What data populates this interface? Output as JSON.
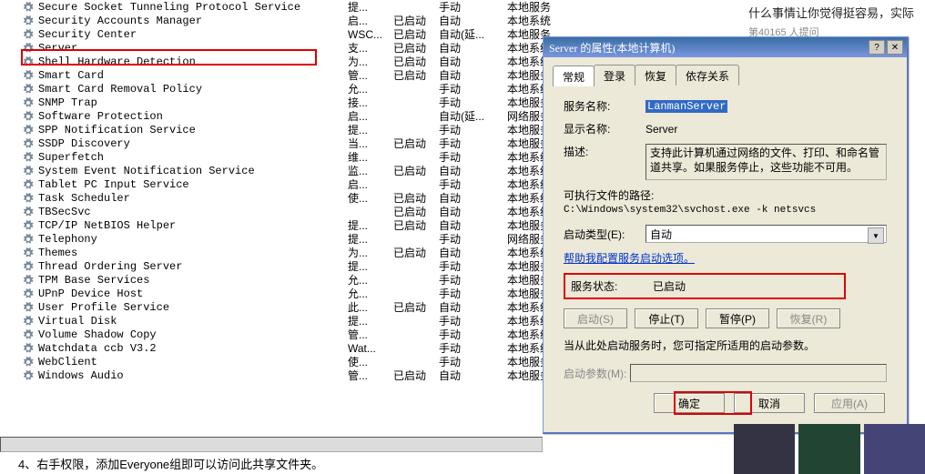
{
  "article": {
    "line1": "什么事情让你觉得挺容易，实际",
    "line2": "第40165 人提问"
  },
  "columns": [
    "name",
    "desc",
    "status",
    "startup",
    "logon"
  ],
  "services": [
    {
      "name": "Secure Socket Tunneling Protocol Service",
      "desc": "提...",
      "status": "",
      "startup": "手动",
      "logon": "本地服务"
    },
    {
      "name": "Security Accounts Manager",
      "desc": "启...",
      "status": "已启动",
      "startup": "自动",
      "logon": "本地系统"
    },
    {
      "name": "Security Center",
      "desc": "WSC...",
      "status": "已启动",
      "startup": "自动(延...",
      "logon": "本地服务"
    },
    {
      "name": "Server",
      "desc": "支...",
      "status": "已启动",
      "startup": "自动",
      "logon": "本地系统"
    },
    {
      "name": "Shell Hardware Detection",
      "desc": "为...",
      "status": "已启动",
      "startup": "自动",
      "logon": "本地系统"
    },
    {
      "name": "Smart Card",
      "desc": "管...",
      "status": "已启动",
      "startup": "自动",
      "logon": "本地服务"
    },
    {
      "name": "Smart Card Removal Policy",
      "desc": "允...",
      "status": "",
      "startup": "手动",
      "logon": "本地系统"
    },
    {
      "name": "SNMP Trap",
      "desc": "接...",
      "status": "",
      "startup": "手动",
      "logon": "本地服务"
    },
    {
      "name": "Software Protection",
      "desc": "启...",
      "status": "",
      "startup": "自动(延...",
      "logon": "网络服务"
    },
    {
      "name": "SPP Notification Service",
      "desc": "提...",
      "status": "",
      "startup": "手动",
      "logon": "本地服务"
    },
    {
      "name": "SSDP Discovery",
      "desc": "当...",
      "status": "已启动",
      "startup": "手动",
      "logon": "本地服务"
    },
    {
      "name": "Superfetch",
      "desc": "维...",
      "status": "",
      "startup": "手动",
      "logon": "本地系统"
    },
    {
      "name": "System Event Notification Service",
      "desc": "监...",
      "status": "已启动",
      "startup": "自动",
      "logon": "本地系统"
    },
    {
      "name": "Tablet PC Input Service",
      "desc": "启...",
      "status": "",
      "startup": "手动",
      "logon": "本地系统"
    },
    {
      "name": "Task Scheduler",
      "desc": "使...",
      "status": "已启动",
      "startup": "自动",
      "logon": "本地系统"
    },
    {
      "name": "TBSecSvc",
      "desc": "",
      "status": "已启动",
      "startup": "自动",
      "logon": "本地系统"
    },
    {
      "name": "TCP/IP NetBIOS Helper",
      "desc": "提...",
      "status": "已启动",
      "startup": "自动",
      "logon": "本地服务"
    },
    {
      "name": "Telephony",
      "desc": "提...",
      "status": "",
      "startup": "手动",
      "logon": "网络服务"
    },
    {
      "name": "Themes",
      "desc": "为...",
      "status": "已启动",
      "startup": "自动",
      "logon": "本地系统"
    },
    {
      "name": "Thread Ordering Server",
      "desc": "提...",
      "status": "",
      "startup": "手动",
      "logon": "本地服务"
    },
    {
      "name": "TPM Base Services",
      "desc": "允...",
      "status": "",
      "startup": "手动",
      "logon": "本地服务"
    },
    {
      "name": "UPnP Device Host",
      "desc": "允...",
      "status": "",
      "startup": "手动",
      "logon": "本地服务"
    },
    {
      "name": "User Profile Service",
      "desc": "此...",
      "status": "已启动",
      "startup": "自动",
      "logon": "本地系统"
    },
    {
      "name": "Virtual Disk",
      "desc": "提...",
      "status": "",
      "startup": "手动",
      "logon": "本地系统"
    },
    {
      "name": "Volume Shadow Copy",
      "desc": "管...",
      "status": "",
      "startup": "手动",
      "logon": "本地系统"
    },
    {
      "name": "Watchdata ccb V3.2",
      "desc": "Wat...",
      "status": "",
      "startup": "手动",
      "logon": "本地系统"
    },
    {
      "name": "WebClient",
      "desc": "使...",
      "status": "",
      "startup": "手动",
      "logon": "本地服务"
    },
    {
      "name": "Windows Audio",
      "desc": "管...",
      "status": "已启动",
      "startup": "自动",
      "logon": "本地服务"
    }
  ],
  "dialog": {
    "title": "Server 的属性(本地计算机)",
    "closeGlyph": "✕",
    "helpGlyph": "?",
    "tabs": [
      "常规",
      "登录",
      "恢复",
      "依存关系"
    ],
    "labels": {
      "serviceName": "服务名称:",
      "displayName": "显示名称:",
      "description": "描述:",
      "exePathLabel": "可执行文件的路径:",
      "startupType": "启动类型(E):",
      "help": "帮助我配置服务启动选项。",
      "statusLabel": "服务状态:",
      "paramsLabel": "启动参数(M):",
      "hint": "当从此处启动服务时，您可指定所适用的启动参数。"
    },
    "values": {
      "serviceName": "LanmanServer",
      "displayName": "Server",
      "description": "支持此计算机通过网络的文件、打印、和命名管道共享。如果服务停止，这些功能不可用。",
      "exePath": "C:\\Windows\\system32\\svchost.exe -k netsvcs",
      "startupSelected": "自动",
      "statusValue": "已启动"
    },
    "actionButtons": {
      "start": "启动(S)",
      "stop": "停止(T)",
      "pause": "暂停(P)",
      "resume": "恢复(R)"
    },
    "footerButtons": {
      "ok": "确定",
      "cancel": "取消",
      "apply": "应用(A)"
    }
  },
  "bottomText": "4、右手权限，添加Everyone组即可以访问此共享文件夹。"
}
